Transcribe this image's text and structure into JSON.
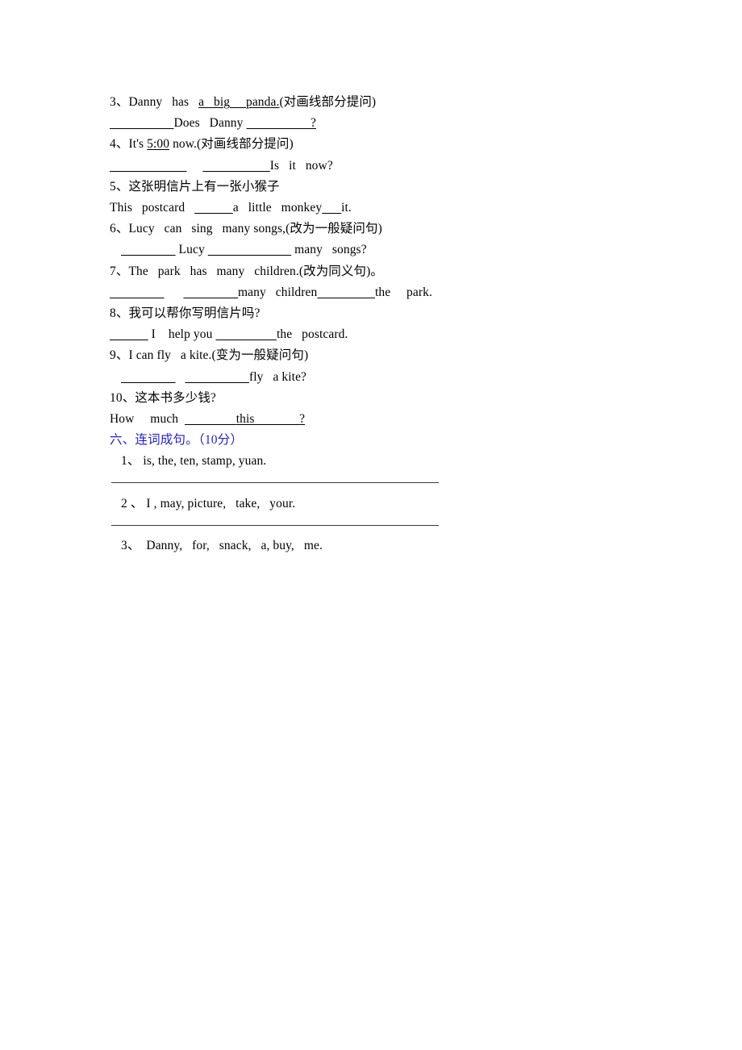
{
  "document": {
    "type": "english-exam-worksheet",
    "background_color": "#ffffff",
    "text_color": "#000000",
    "heading_color": "#2222cc"
  },
  "section_five_items": {
    "q3": {
      "number": "3、",
      "stem_before": "Danny   has   ",
      "stem_underlined": "a   big     panda.",
      "stem_after": "(对画线部分提问)",
      "answer_blank_1": "                    ",
      "answer_mid_1": "Does   Danny ",
      "answer_blank_2": "                    ",
      "answer_tail": "?"
    },
    "q4": {
      "number": "4、",
      "stem_before": "It's ",
      "stem_underlined": "5:00",
      "stem_after": " now.(对画线部分提问)",
      "answer_blank_1": "                        ",
      "answer_gap": "     ",
      "answer_blank_2": "                     ",
      "answer_tail": "Is   it   now?"
    },
    "q5": {
      "number": "5、",
      "stem": "这张明信片上有一张小猴子",
      "answer_before": "This   postcard   ",
      "answer_blank_1": "            ",
      "answer_mid": "a   little   monkey",
      "answer_blank_2": "      ",
      "answer_tail": "it."
    },
    "q6": {
      "number": "6、",
      "stem": "Lucy   can   sing   many songs,(改为一般疑问句)",
      "answer_blank_1": "                 ",
      "answer_mid": " Lucy ",
      "answer_blank_2": "                          ",
      "answer_tail": " many   songs?"
    },
    "q7": {
      "number": "7、",
      "stem": "The   park   has   many   children.(改为同义句)。",
      "answer_blank_1": "                 ",
      "answer_gap": "      ",
      "answer_blank_2": "                 ",
      "answer_mid": "many   children",
      "answer_blank_3": "                  ",
      "answer_tail": "the     park."
    },
    "q8": {
      "number": "8、",
      "stem": "我可以帮你写明信片吗?",
      "answer_blank_1": "            ",
      "answer_mid": " I    help you ",
      "answer_blank_2": "                   ",
      "answer_tail": "the   postcard."
    },
    "q9": {
      "number": "9、",
      "stem": "I can fly   a kite.(变为一般疑问句)",
      "answer_blank_1": "                 ",
      "answer_gap": "   ",
      "answer_blank_2": "                    ",
      "answer_tail": "fly   a kite?"
    },
    "q10": {
      "number": "10、",
      "stem": "这本书多少钱?",
      "answer_before": "How     much  ",
      "answer_blank_1": "                ",
      "answer_mid": "this",
      "answer_blank_2": "              ",
      "answer_tail": "?"
    }
  },
  "section_six": {
    "heading": "六、连词成句。（10分）",
    "items": [
      {
        "number": "1、",
        "words": " is, the, ten, stamp, yuan."
      },
      {
        "number": "2 、",
        "words": " I , may, picture,   take,   your."
      },
      {
        "number": "3、",
        "words": "  Danny,   for,   snack,   a, buy,   me."
      }
    ]
  }
}
